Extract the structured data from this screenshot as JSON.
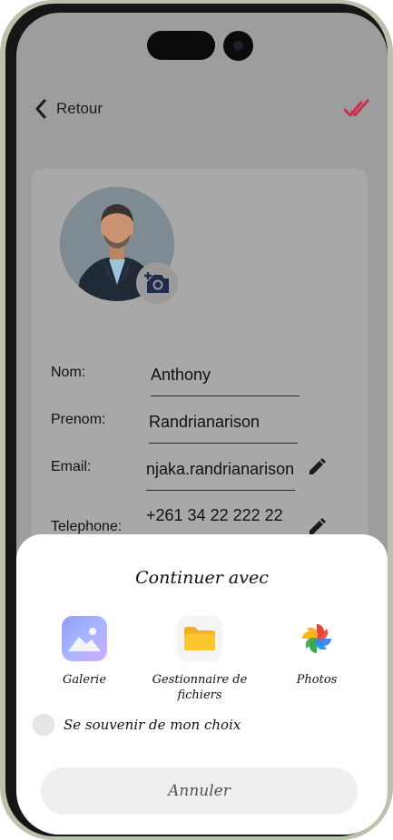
{
  "header": {
    "back_label": "Retour",
    "accent_color": "#c9304a"
  },
  "profile": {
    "fields": [
      {
        "label": "Nom:",
        "value": "Anthony"
      },
      {
        "label": "Prenom:",
        "value": "Randrianarison"
      },
      {
        "label": "Email:",
        "value": "njaka.randrianarison"
      },
      {
        "label": "Telephone:",
        "value": "+261 34 22 222 22"
      }
    ]
  },
  "sheet": {
    "title": "Continuer avec",
    "apps": [
      {
        "label": "Galerie",
        "icon": "gallery-icon"
      },
      {
        "label": "Gestionnaire de fichiers",
        "label_line1": "Gestionnaire de",
        "label_line2": "fichiers",
        "icon": "folder-icon"
      },
      {
        "label": "Photos",
        "icon": "google-photos-icon"
      }
    ],
    "remember_label": "Se souvenir de mon choix",
    "cancel_label": "Annuler"
  }
}
